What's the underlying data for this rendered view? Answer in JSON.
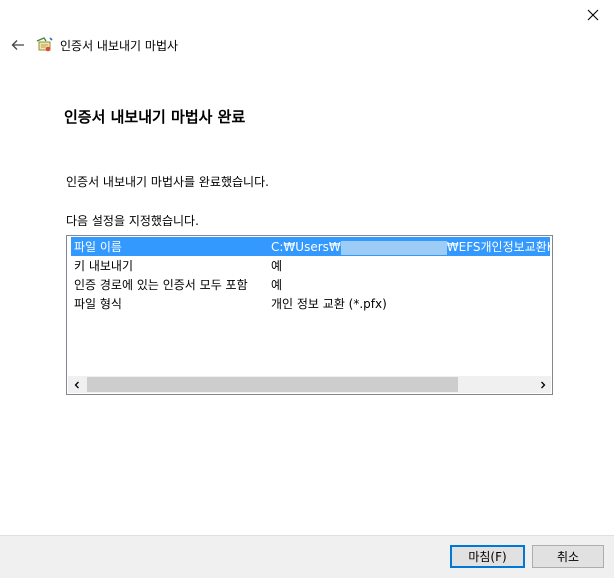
{
  "window": {
    "title": "인증서 내보내기 마법사",
    "close_icon": "close-icon",
    "back_icon": "back-arrow-icon",
    "app_icon": "certificate-wizard-icon"
  },
  "page": {
    "heading": "인증서 내보내기 마법사 완료",
    "description": "인증서 내보내기 마법사를 완료했습니다.",
    "settings_intro": "다음 설정을 지정했습니다."
  },
  "settings": {
    "rows": [
      {
        "name": "파일 이름",
        "value_prefix": "C:₩Users₩",
        "value_suffix": "₩EFS개인정보교환KEY.p",
        "selected": true
      },
      {
        "name": "키 내보내기",
        "value": "예"
      },
      {
        "name": "인증 경로에 있는 인증서 모두 포함",
        "value": "예"
      },
      {
        "name": "파일 형식",
        "value": "개인 정보 교환 (*.pfx)"
      }
    ],
    "scroll_left_icon": "chevron-left-icon",
    "scroll_right_icon": "chevron-right-icon"
  },
  "buttons": {
    "finish": "마침(F)",
    "cancel": "취소"
  },
  "colors": {
    "selection": "#3399ff",
    "footer": "#f0f0f0",
    "primary_border": "#0078d7"
  }
}
